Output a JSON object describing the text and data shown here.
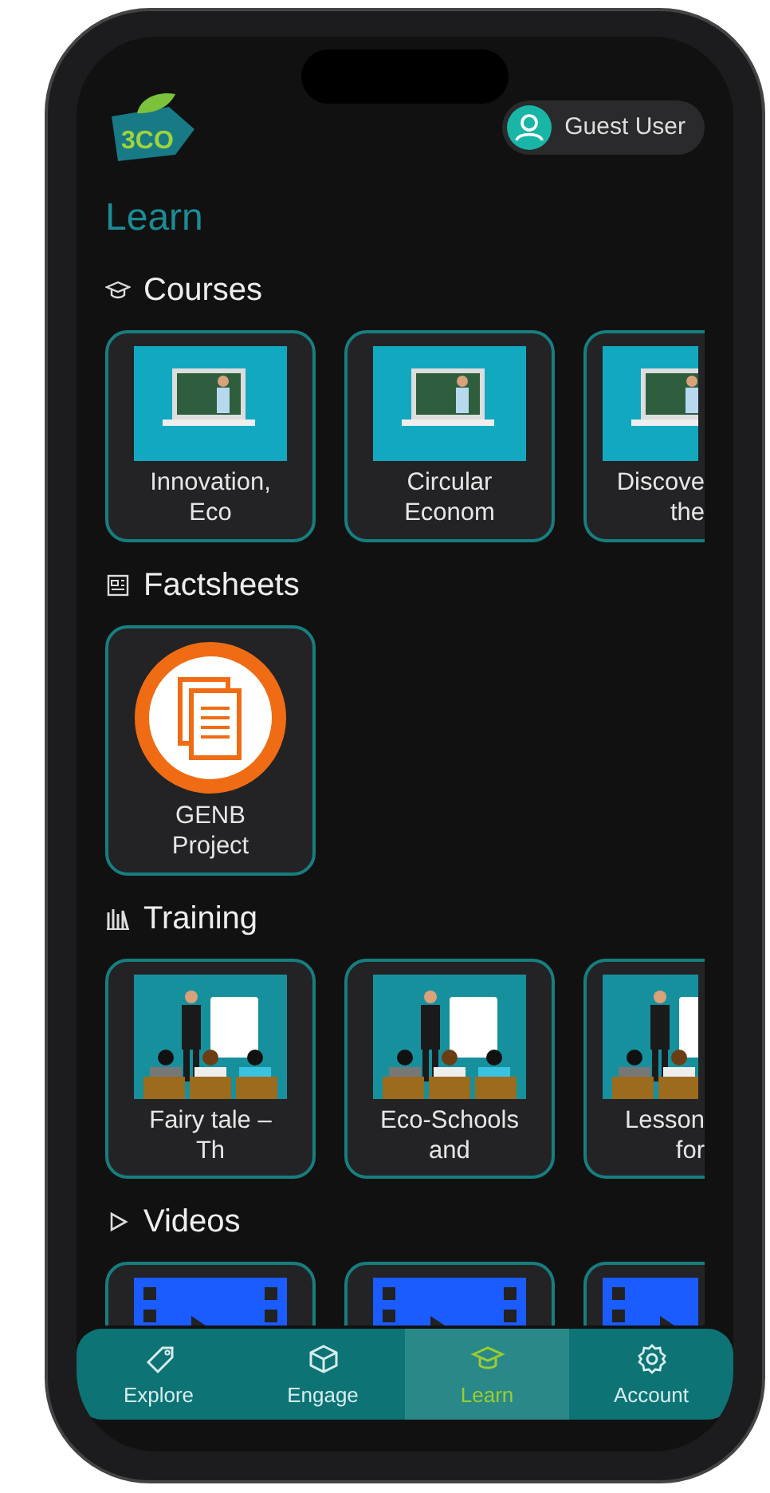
{
  "header": {
    "logo": "3CO",
    "user": "Guest User"
  },
  "title": "Learn",
  "sections": [
    {
      "kind": "courses",
      "heading": "Courses",
      "items": [
        {
          "kind": "lesson",
          "title": "Innovation,\nEco"
        },
        {
          "kind": "lesson",
          "title": "Circular\nEconom"
        },
        {
          "kind": "lesson",
          "title": "Discove\nthe"
        }
      ]
    },
    {
      "kind": "factsheets",
      "heading": "Factsheets",
      "items": [
        {
          "kind": "document",
          "title": "GENB\nProject"
        }
      ]
    },
    {
      "kind": "training",
      "heading": "Training",
      "items": [
        {
          "kind": "training",
          "title": "Fairy tale –\nTh"
        },
        {
          "kind": "training",
          "title": "Eco-Schools\nand"
        },
        {
          "kind": "training",
          "title": "Lesson\nfor"
        }
      ]
    },
    {
      "kind": "videos",
      "heading": "Videos",
      "items": [
        {
          "kind": "video"
        },
        {
          "kind": "video"
        },
        {
          "kind": "video"
        }
      ]
    }
  ],
  "nav": [
    {
      "kind": "explore",
      "label": "Explore",
      "selected": false
    },
    {
      "kind": "engage",
      "label": "Engage",
      "selected": false
    },
    {
      "kind": "learn",
      "label": "Learn",
      "selected": true
    },
    {
      "kind": "account",
      "label": "Account",
      "selected": false
    }
  ]
}
